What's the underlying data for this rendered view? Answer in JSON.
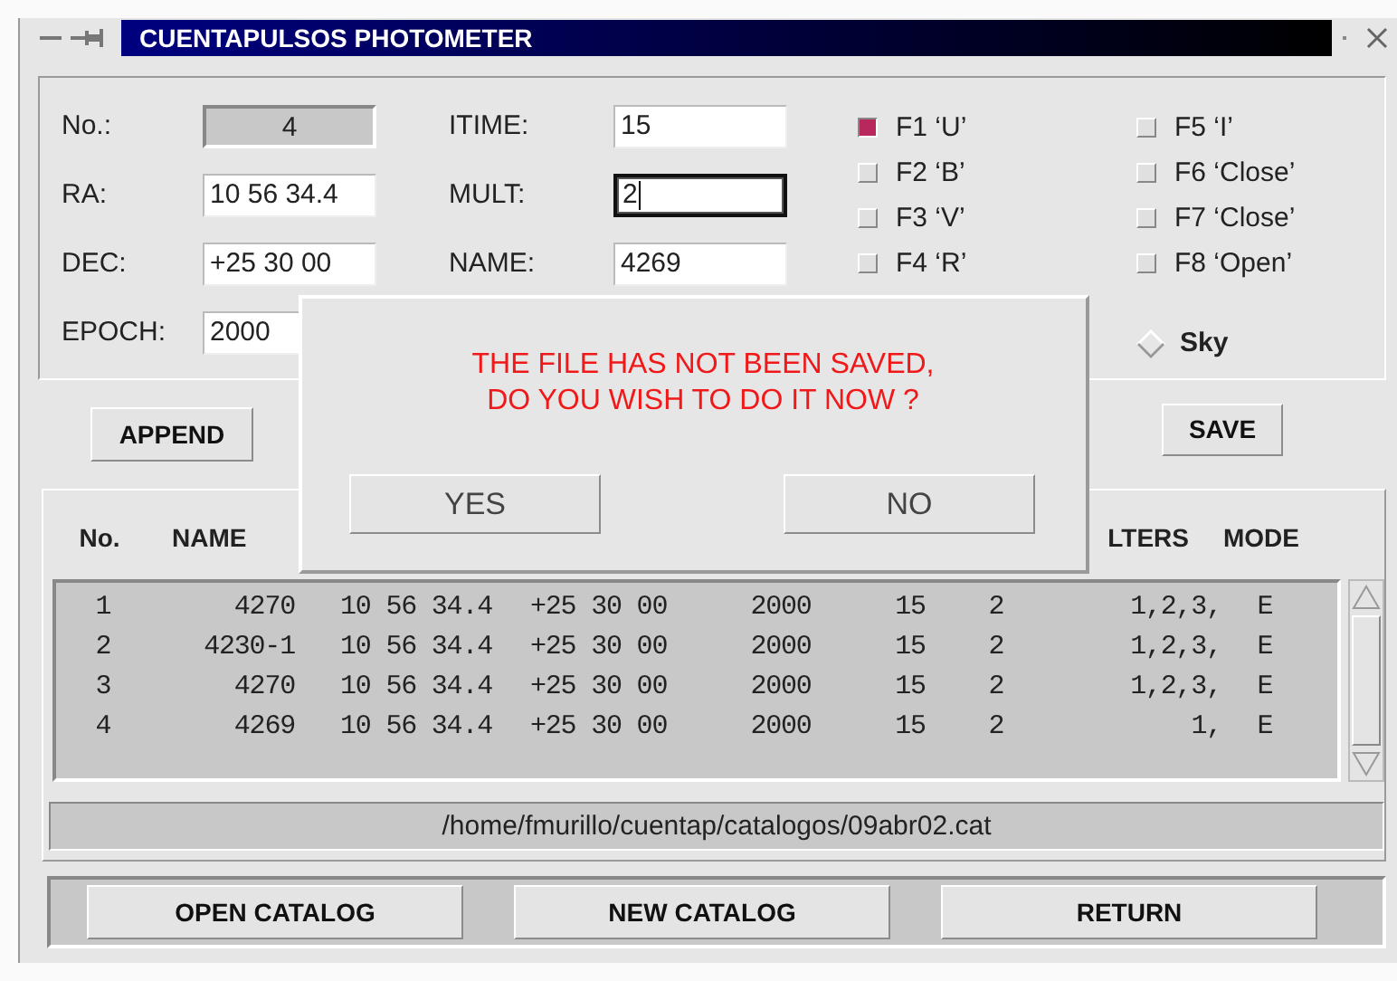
{
  "window": {
    "title": "CUENTAPULSOS PHOTOMETER"
  },
  "fields": [
    {
      "label": "No.:",
      "value": "4",
      "kind": "display"
    },
    {
      "label": "ITIME:",
      "value": "15",
      "kind": "entry",
      "focused": false
    },
    {
      "label": "RA:",
      "value": "10 56 34.4",
      "kind": "entry",
      "focused": false
    },
    {
      "label": "MULT:",
      "value": "2",
      "kind": "entry",
      "focused": true
    },
    {
      "label": "DEC:",
      "value": "+25 30 00",
      "kind": "entry",
      "focused": false
    },
    {
      "label": "NAME:",
      "value": "4269",
      "kind": "entry",
      "focused": false
    },
    {
      "label": "EPOCH:",
      "value": "2000",
      "kind": "entry",
      "focused": false
    }
  ],
  "filters": [
    {
      "label": "F1 ‘U’",
      "checked": true
    },
    {
      "label": "F2 ‘B’",
      "checked": false
    },
    {
      "label": "F3 ‘V’",
      "checked": false
    },
    {
      "label": "F4 ‘R’",
      "checked": false
    },
    {
      "label": "F5 ‘I’",
      "checked": false
    },
    {
      "label": "F6 ‘Close’",
      "checked": false
    },
    {
      "label": "F7 ‘Close’",
      "checked": false
    },
    {
      "label": "F8 ‘Open’",
      "checked": false
    }
  ],
  "sky": {
    "label": "Sky",
    "selected": false
  },
  "actions": {
    "append": "APPEND",
    "save": "SAVE"
  },
  "table": {
    "headers": {
      "column_1": "No.",
      "column_2": "NAME",
      "column_8": "LTERS",
      "column_9": "MODE"
    },
    "rows": [
      [
        "1",
        "4270",
        "10 56 34.4",
        "+25 30 00",
        "2000",
        "15",
        "2",
        "1,2,3,",
        "E"
      ],
      [
        "2",
        "4230-1",
        "10 56 34.4",
        "+25 30 00",
        "2000",
        "15",
        "2",
        "1,2,3,",
        "E"
      ],
      [
        "3",
        "4270",
        "10 56 34.4",
        "+25 30 00",
        "2000",
        "15",
        "2",
        "1,2,3,",
        "E"
      ],
      [
        "4",
        "4269",
        "10 56 34.4",
        "+25 30 00",
        "2000",
        "15",
        "2",
        "1,",
        "E"
      ]
    ]
  },
  "path": "/home/fmurillo/cuentap/catalogos/09abr02.cat",
  "bottom_buttons": [
    "OPEN CATALOG",
    "NEW CATALOG",
    "RETURN"
  ],
  "dialog": {
    "message": "THE FILE HAS NOT BEEN SAVED,\nDO YOU WISH TO DO IT NOW ?",
    "buttons": [
      "YES",
      "NO"
    ]
  }
}
